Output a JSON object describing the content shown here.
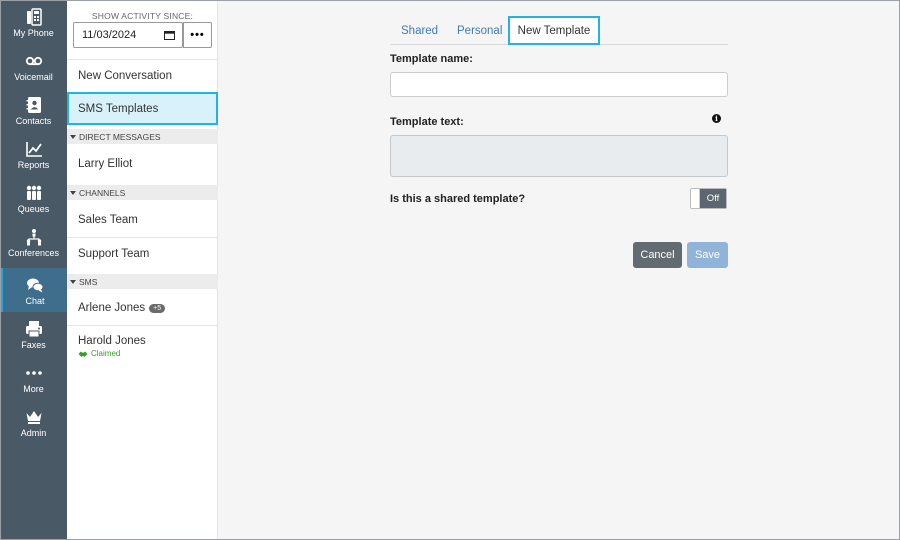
{
  "rail": {
    "items": [
      {
        "label": "My Phone",
        "icon": "phone-icon"
      },
      {
        "label": "Voicemail",
        "icon": "voicemail-icon"
      },
      {
        "label": "Contacts",
        "icon": "contacts-icon"
      },
      {
        "label": "Reports",
        "icon": "reports-icon"
      },
      {
        "label": "Queues",
        "icon": "queues-icon"
      },
      {
        "label": "Conferences",
        "icon": "conferences-icon"
      },
      {
        "label": "Chat",
        "icon": "chat-icon",
        "active": true
      },
      {
        "label": "Faxes",
        "icon": "fax-icon"
      },
      {
        "label": "More",
        "icon": "more-icon"
      },
      {
        "label": "Admin",
        "icon": "crown-icon"
      }
    ]
  },
  "activity": {
    "label": "SHOW ACTIVITY SINCE:",
    "date": "11/03/2024",
    "more_button": "•••"
  },
  "nav": {
    "new_conversation": "New Conversation",
    "sms_templates": "SMS Templates"
  },
  "sections": {
    "direct_messages": "DIRECT MESSAGES",
    "channels": "CHANNELS",
    "sms": "SMS"
  },
  "direct_messages": [
    {
      "name": "Larry Elliot"
    }
  ],
  "channels": [
    {
      "name": "Sales Team"
    },
    {
      "name": "Support Team"
    }
  ],
  "sms": [
    {
      "name": "Arlene Jones",
      "badge": "+5"
    },
    {
      "name": "Harold Jones",
      "status": "Claimed"
    }
  ],
  "tabs": [
    {
      "label": "Shared"
    },
    {
      "label": "Personal"
    },
    {
      "label": "New Template",
      "active": true
    }
  ],
  "form": {
    "template_name_label": "Template name:",
    "template_name_value": "",
    "template_text_label": "Template text:",
    "template_text_value": "",
    "info_icon": "i",
    "shared_label": "Is this a shared template?",
    "shared_state": "Off",
    "cancel": "Cancel",
    "save": "Save"
  },
  "colors": {
    "rail_bg": "#4a5966",
    "rail_active": "#3f6e8d",
    "accent": "#23b3e3",
    "link": "#3f7bb5",
    "cancel_btn": "#626a72",
    "save_btn": "#8fb3d9",
    "claimed": "#3a9c2a"
  }
}
